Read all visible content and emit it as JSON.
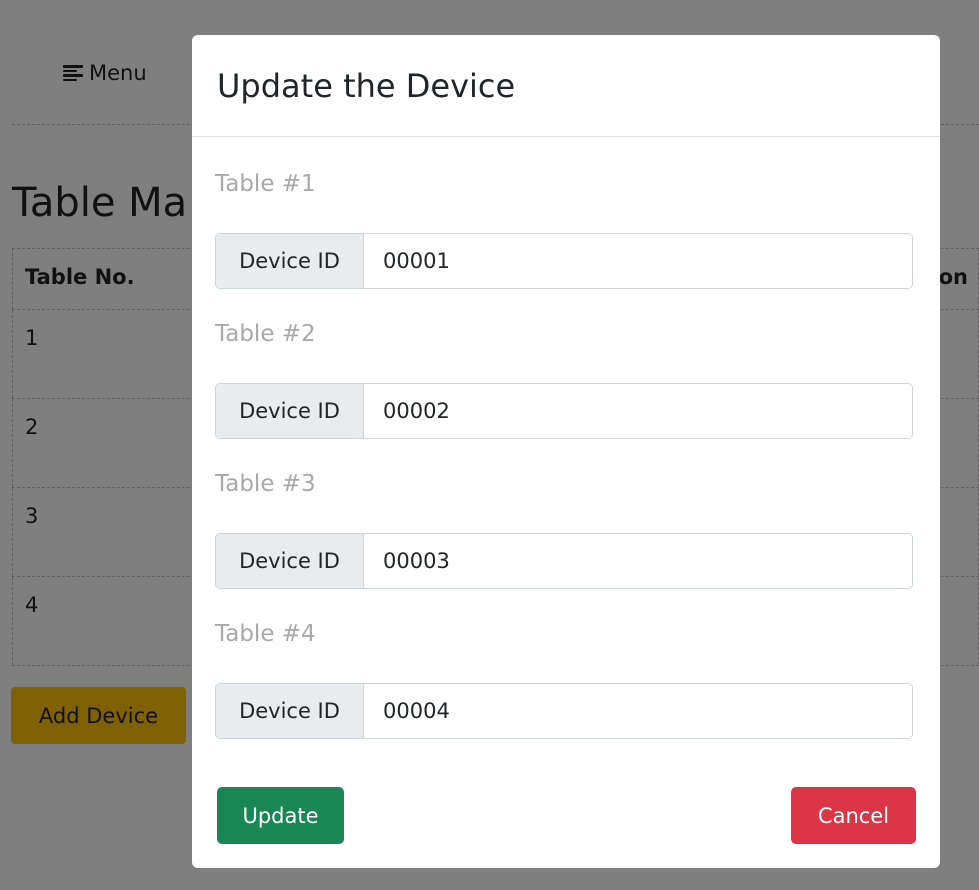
{
  "background": {
    "menu_label": "Menu",
    "page_title": "Table Ma",
    "table": {
      "headers": [
        "Table No.",
        "on"
      ],
      "rows": [
        "1",
        "2",
        "3",
        "4"
      ]
    },
    "add_device_label": "Add Device"
  },
  "modal": {
    "title": "Update the Device",
    "fields": [
      {
        "label": "Table #1",
        "prefix": "Device ID",
        "value": "00001"
      },
      {
        "label": "Table #2",
        "prefix": "Device ID",
        "value": "00002"
      },
      {
        "label": "Table #3",
        "prefix": "Device ID",
        "value": "00003"
      },
      {
        "label": "Table #4",
        "prefix": "Device ID",
        "value": "00004"
      }
    ],
    "update_label": "Update",
    "cancel_label": "Cancel"
  },
  "colors": {
    "update": "#198754",
    "cancel": "#dc3545",
    "add_device": "#ffc107"
  }
}
